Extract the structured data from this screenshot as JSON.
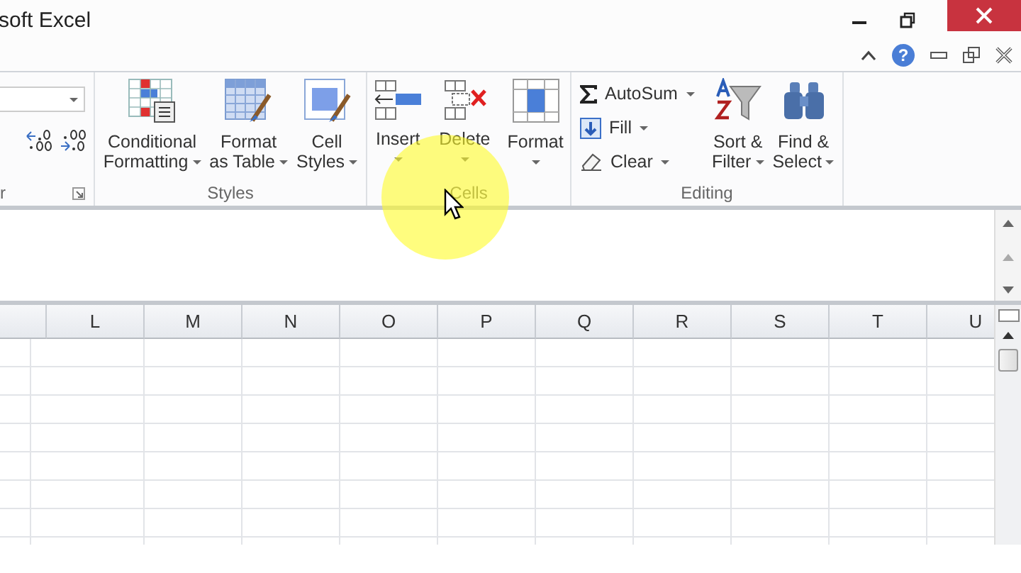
{
  "window": {
    "title": "soft Excel"
  },
  "help_button": "?",
  "ribbon": {
    "groups": [
      {
        "kind": "number",
        "label": "r"
      },
      {
        "kind": "styles",
        "label": "Styles",
        "buttons": [
          {
            "lines": [
              "Conditional",
              "Formatting"
            ],
            "dropdown": true
          },
          {
            "lines": [
              "Format",
              "as Table"
            ],
            "dropdown": true
          },
          {
            "lines": [
              "Cell",
              "Styles"
            ],
            "dropdown": true
          }
        ]
      },
      {
        "kind": "cells",
        "label": "Cells",
        "buttons": [
          {
            "lines": [
              "Insert"
            ],
            "dropdown": true
          },
          {
            "lines": [
              "Delete"
            ],
            "dropdown": true
          },
          {
            "lines": [
              "Format"
            ],
            "dropdown": true
          }
        ]
      },
      {
        "kind": "editing",
        "label": "Editing",
        "small_buttons": [
          {
            "label": "AutoSum",
            "dropdown": true
          },
          {
            "label": "Fill",
            "dropdown": true
          },
          {
            "label": "Clear",
            "dropdown": true
          }
        ],
        "buttons": [
          {
            "lines": [
              "Sort &",
              "Filter"
            ],
            "dropdown": true
          },
          {
            "lines": [
              "Find &",
              "Select"
            ],
            "dropdown": true
          }
        ]
      }
    ]
  },
  "sheet": {
    "columns": [
      "",
      "L",
      "M",
      "N",
      "O",
      "P",
      "Q",
      "R",
      "S",
      "T",
      "U"
    ]
  }
}
